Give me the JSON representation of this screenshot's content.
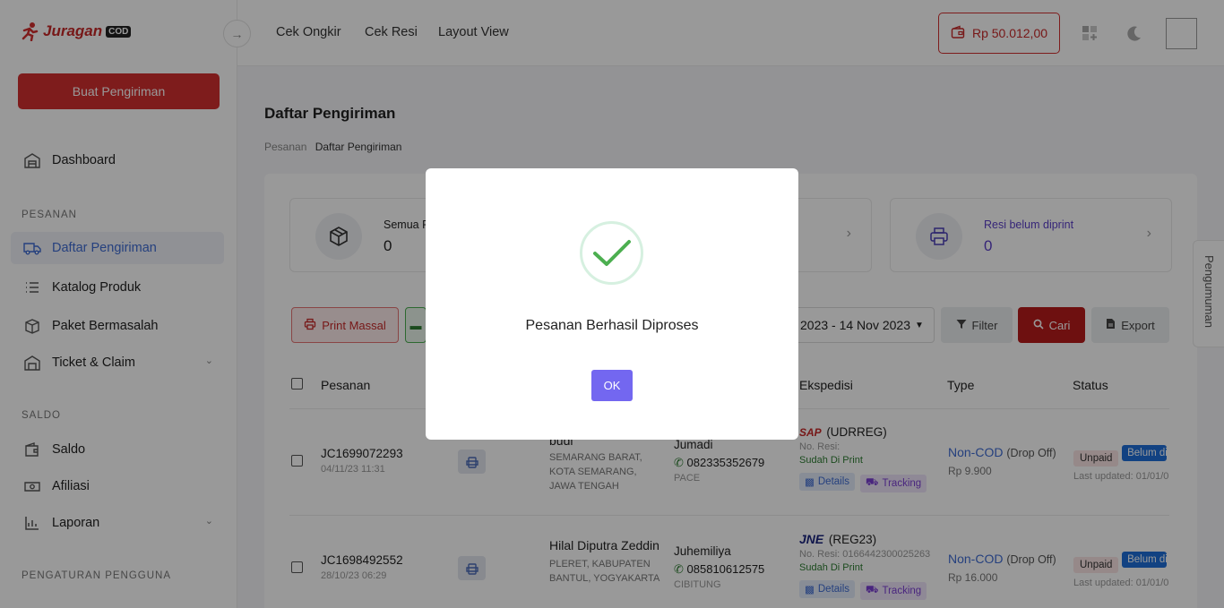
{
  "brand": {
    "name": "Juragan",
    "badge": "COD"
  },
  "sidebar": {
    "create_button": "Buat Pengiriman",
    "items": [
      {
        "label": "Dashboard"
      },
      {
        "label": "Daftar Pengiriman"
      },
      {
        "label": "Katalog Produk"
      },
      {
        "label": "Paket Bermasalah"
      },
      {
        "label": "Ticket & Claim"
      },
      {
        "label": "Saldo"
      },
      {
        "label": "Afiliasi"
      },
      {
        "label": "Laporan"
      }
    ],
    "sections": [
      "PESANAN",
      "SALDO",
      "PENGATURAN PENGGUNA"
    ]
  },
  "topbar": {
    "links": [
      "Cek Ongkir",
      "Cek Resi",
      "Layout View"
    ],
    "balance": "Rp 50.012,00"
  },
  "page": {
    "title": "Daftar Pengiriman",
    "breadcrumb": [
      "Pesanan",
      "Daftar Pengiriman"
    ]
  },
  "stats": [
    {
      "label": "Semua Pe",
      "value": "0"
    },
    {
      "label": "Resi belum diprint",
      "value": "0"
    }
  ],
  "toolbar": {
    "print_massal": "Print Massal",
    "date_range": "2023 - 14 Nov 2023",
    "filter": "Filter",
    "cari": "Cari",
    "export": "Export"
  },
  "table": {
    "headers": [
      "Pesanan",
      "Ekspedisi",
      "Type",
      "Status"
    ],
    "rows": [
      {
        "id": "JC1699072293",
        "date": "04/11/23 11:31",
        "recipient": "budi",
        "address": [
          "SEMARANG BARAT,",
          "KOTA SEMARANG,",
          "JAWA TENGAH"
        ],
        "sender": "Jumadi",
        "phone": "082335352679",
        "origin": "PACE",
        "courier_logo": "SAP",
        "service": "(UDRREG)",
        "resi": "No. Resi:",
        "print_status": "Sudah Di Print",
        "details": "Details",
        "tracking": "Tracking",
        "type": "Non-COD",
        "type_note": "(Drop Off)",
        "price": "Rp 9.900",
        "payment": "Unpaid",
        "status": "Belum di",
        "updated": "Last updated: 01/01/0"
      },
      {
        "id": "JC1698492552",
        "date": "28/10/23 06:29",
        "recipient": "Hilal Diputra Zeddin",
        "address": [
          "PLERET, KABUPATEN",
          "BANTUL, YOGYAKARTA"
        ],
        "sender": "Juhemiliya",
        "phone": "085810612575",
        "origin": "CIBITUNG",
        "courier_logo": "JNE",
        "service": "(REG23)",
        "resi": "No. Resi: 0166442300025263",
        "print_status": "Sudah Di Print",
        "details": "Details",
        "tracking": "Tracking",
        "type": "Non-COD",
        "type_note": "(Drop Off)",
        "price": "Rp 16.000",
        "payment": "Unpaid",
        "status": "Belum di",
        "updated": "Last updated: 01/01/0"
      }
    ]
  },
  "announcement": "Pengumuman",
  "modal": {
    "message": "Pesanan Berhasil Diproses",
    "ok": "OK"
  },
  "colors": {
    "brand_red": "#d32f2f",
    "accent_blue": "#3f6cd3",
    "modal_button": "#7367f0",
    "success_green": "#4caf50"
  }
}
